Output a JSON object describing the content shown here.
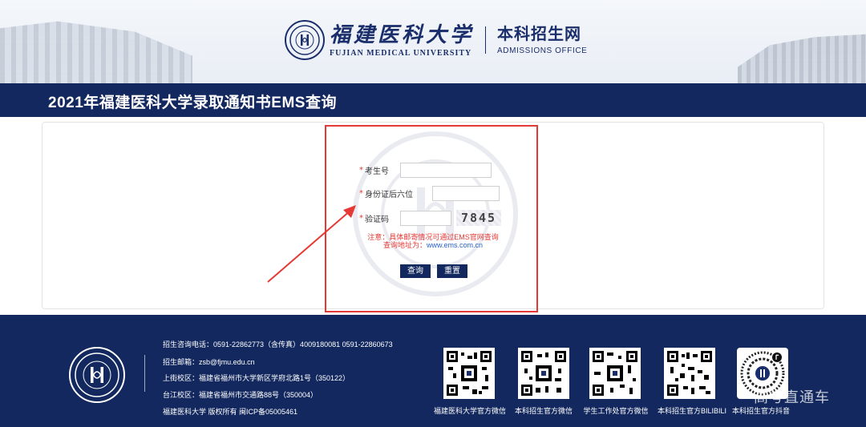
{
  "header": {
    "univ_name_cn": "福建医科大学",
    "univ_name_en": "FUJIAN MEDICAL UNIVERSITY",
    "office_name_cn": "本科招生网",
    "office_name_en": "ADMISSIONS OFFICE",
    "logo_icon": "university-seal-icon"
  },
  "page": {
    "title": "2021年福建医科大学录取通知书EMS查询"
  },
  "form": {
    "fields": [
      {
        "label": "考生号",
        "required": "*",
        "value": ""
      },
      {
        "label": "身份证后六位",
        "required": "*",
        "value": ""
      },
      {
        "label": "验证码",
        "required": "*",
        "value": ""
      }
    ],
    "captcha_text": "7845",
    "notice_line1": "注意：具体邮寄情况可通过EMS官网查询",
    "notice_line2_prefix": "查询地址为：",
    "notice_line2_link": "www.ems.com.cn",
    "query_button": "查询",
    "reset_button": "重置",
    "highlight_color": "#e53935"
  },
  "footer": {
    "phone": "招生咨询电话：0591-22862773（含传真）4009180081 0591-22860673",
    "email": "招生邮箱：zsb@fjmu.edu.cn",
    "campus1": "上街校区：福建省福州市大学新区学府北路1号（350122）",
    "campus2": "台江校区：福建省福州市交通路88号（350004）",
    "copyright": "福建医科大学 版权所有 闽ICP备05005461",
    "qrcodes": [
      "福建医科大学官方微信",
      "本科招生官方微信",
      "学生工作处官方微信",
      "本科招生官方BILIBILI",
      "本科招生官方抖音"
    ],
    "watermark": "高考直通车"
  },
  "colors": {
    "navy": "#13285e",
    "accent_red": "#e53935",
    "link_blue": "#2a62c9"
  }
}
